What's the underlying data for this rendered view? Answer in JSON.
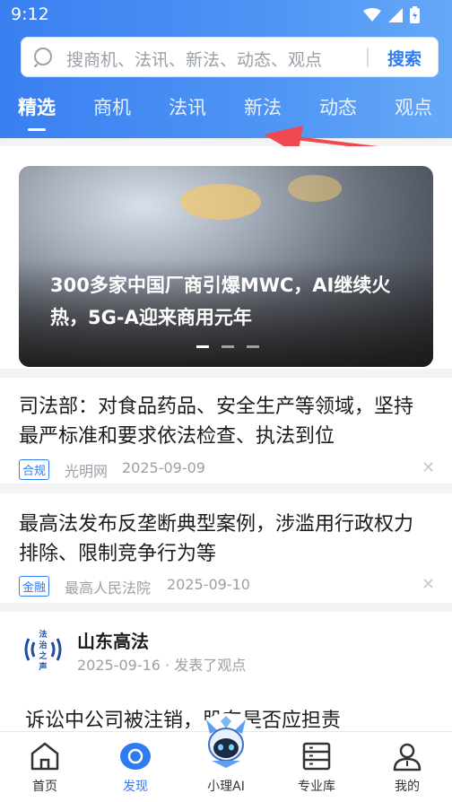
{
  "status": {
    "time": "9:12"
  },
  "search": {
    "placeholder": "搜商机、法讯、新法、动态、观点",
    "button": "搜索"
  },
  "tabs": [
    {
      "label": "精选",
      "active": true
    },
    {
      "label": "商机"
    },
    {
      "label": "法讯"
    },
    {
      "label": "新法"
    },
    {
      "label": "动态"
    },
    {
      "label": "观点"
    }
  ],
  "banner": {
    "title": "300多家中国厂商引爆MWC，AI继续火热，5G-A迎来商用元年",
    "dots": 3,
    "active_dot": 1
  },
  "news": [
    {
      "title": "司法部：对食品药品、安全生产等领域，坚持最严标准和要求依法检查、执法到位",
      "tag": "合规",
      "source": "光明网",
      "date": "2025-09-09"
    },
    {
      "title": "最高法发布反垄断典型案例，涉滥用行政权力排除、限制竞争行为等",
      "tag": "金融",
      "source": "最高人民法院",
      "date": "2025-09-10"
    }
  ],
  "opinion": {
    "org_logo_text": "法治之声",
    "org_name": "山东高法",
    "meta": "2025-09-16 · 发表了观点",
    "title": "诉讼中公司被注销，股东是否应担责"
  },
  "bottom_nav": [
    {
      "label": "首页",
      "icon": "home-icon"
    },
    {
      "label": "发现",
      "icon": "discover-icon",
      "active": true
    },
    {
      "label": "小理AI",
      "icon": "ai-assistant-icon"
    },
    {
      "label": "专业库",
      "icon": "library-icon"
    },
    {
      "label": "我的",
      "icon": "profile-icon"
    }
  ],
  "colors": {
    "accent": "#2f7cf2",
    "header": "#4a8ff4",
    "arrow": "#f0484f"
  }
}
